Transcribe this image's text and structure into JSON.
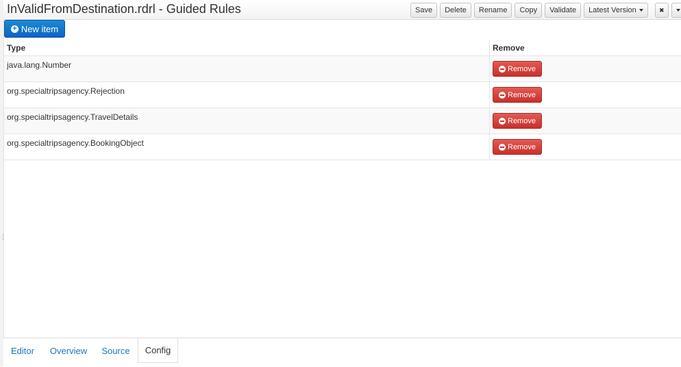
{
  "header": {
    "title": "InValidFromDestination.rdrl - Guided Rules",
    "buttons": {
      "save": "Save",
      "delete": "Delete",
      "rename": "Rename",
      "copy": "Copy",
      "validate": "Validate",
      "latest_version": "Latest Version",
      "close": "✖",
      "dropdown": "",
      "collapse": "⌃"
    }
  },
  "new_item_label": "New item",
  "table": {
    "columns": [
      "Type",
      "Remove"
    ],
    "rows": [
      {
        "type": "java.lang.Number",
        "remove_label": "Remove"
      },
      {
        "type": "org.specialtripsagency.Rejection",
        "remove_label": "Remove"
      },
      {
        "type": "org.specialtripsagency.TravelDetails",
        "remove_label": "Remove"
      },
      {
        "type": "org.specialtripsagency.BookingObject",
        "remove_label": "Remove"
      }
    ]
  },
  "tabs": [
    {
      "label": "Editor"
    },
    {
      "label": "Overview"
    },
    {
      "label": "Source"
    },
    {
      "label": "Config"
    }
  ],
  "active_tab": "Config",
  "colors": {
    "primary": "#0f64c4",
    "danger": "#c9302c",
    "link": "#1c74c4"
  }
}
